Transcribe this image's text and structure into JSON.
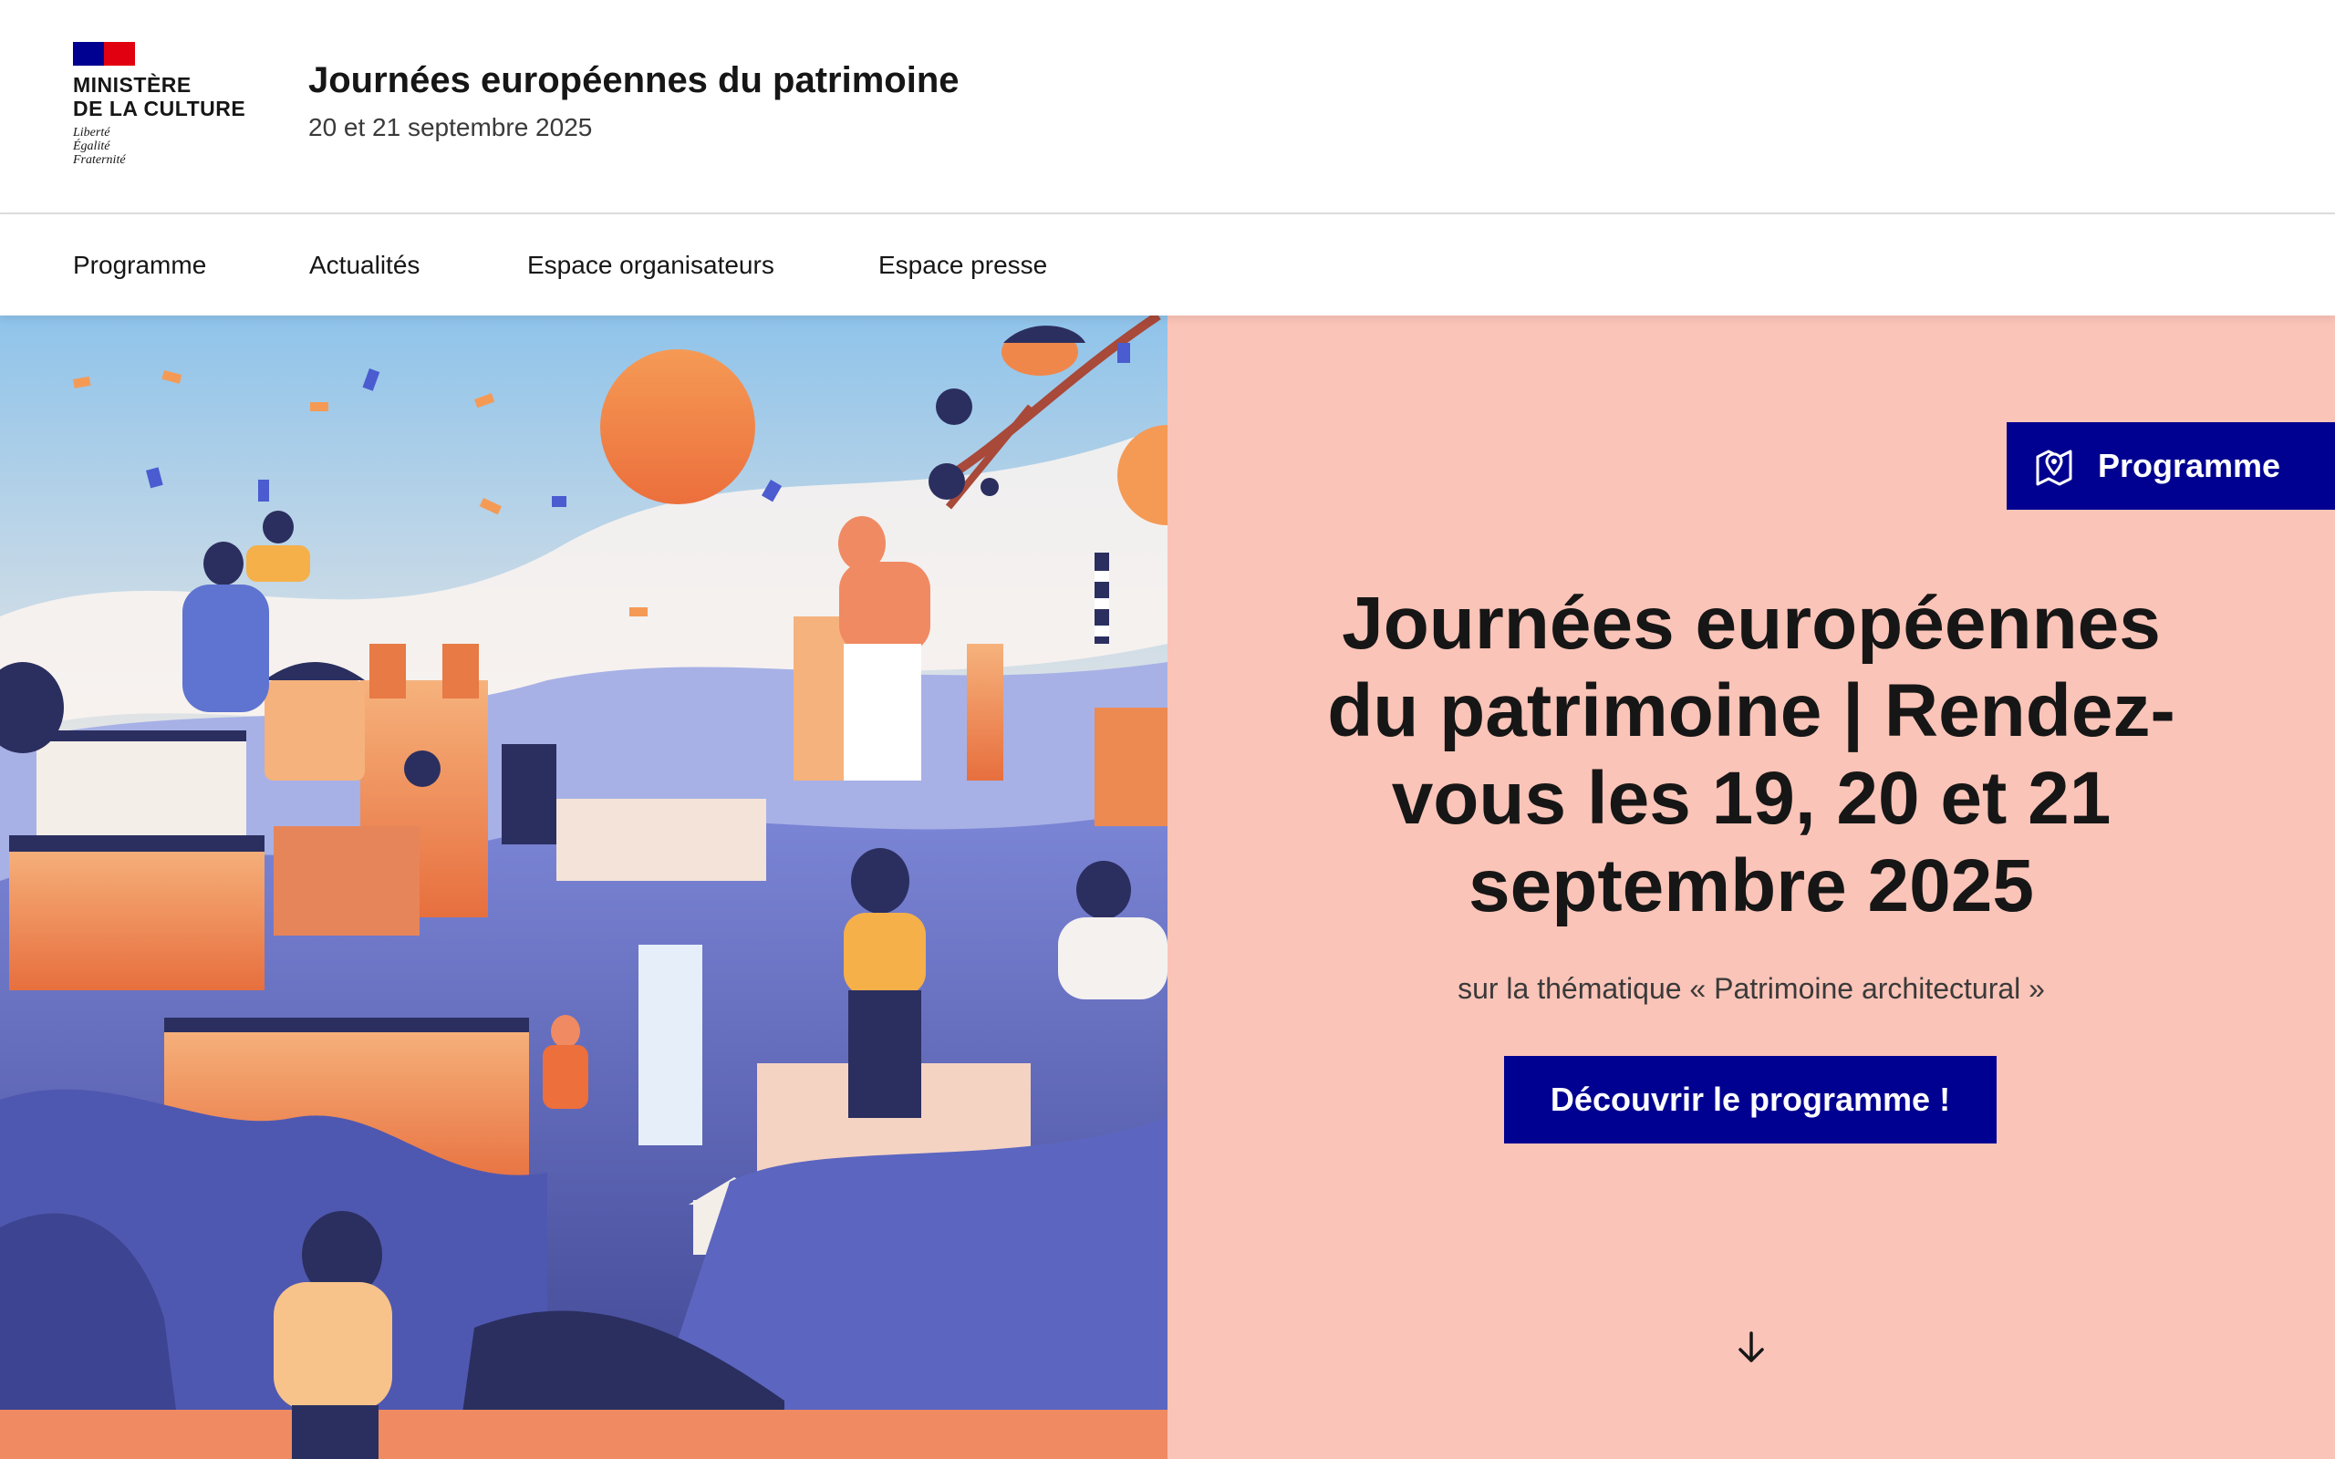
{
  "header": {
    "logo": {
      "ministry": "MINISTÈRE\nDE LA CULTURE",
      "motto": "Liberté\nÉgalité\nFraternité"
    },
    "title": "Journées européennes  du patrimoine",
    "tagline": "20 et 21 septembre 2025"
  },
  "nav": {
    "items": [
      {
        "label": "Programme"
      },
      {
        "label": "Actualités"
      },
      {
        "label": "Espace organisateurs"
      },
      {
        "label": "Espace presse"
      }
    ]
  },
  "hero": {
    "program_button": {
      "label": "Programme",
      "icon": "map-pin-icon"
    },
    "heading_strong": "Journées européennes du patrimoine |",
    "heading_rest": " Rendez-vous les 19, 20 et 21 septembre 2025",
    "subtitle": "sur la thématique «  Patrimoine architectural »",
    "cta_label": "Découvrir le programme !",
    "scroll_icon": "arrow-down-icon"
  },
  "colors": {
    "brand_blue": "#000091",
    "brand_red": "#e1000f",
    "hero_panel": "#fbc4b8",
    "text": "#161616"
  }
}
